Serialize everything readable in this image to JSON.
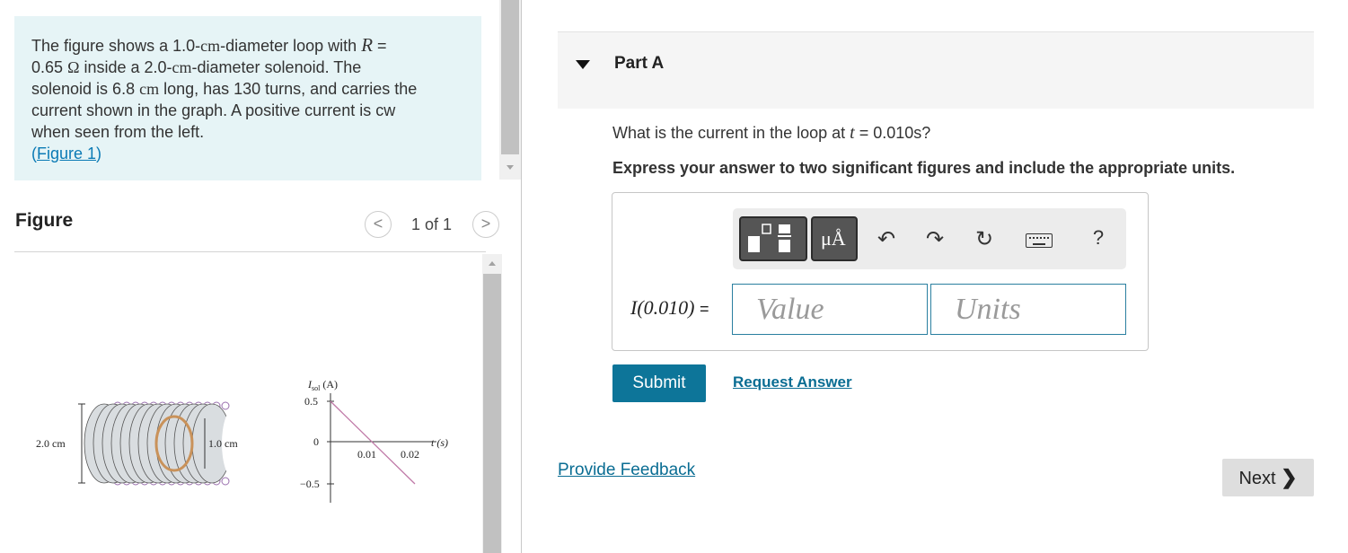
{
  "problem": {
    "text_1": "The figure shows a 1.0-",
    "unit_cm": "cm",
    "text_2": "-diameter loop with ",
    "R_symbol": "R",
    "text_3": " =",
    "resistance": "0.65",
    "ohm": "Ω",
    "text_4": " inside a 2.0-",
    "text_5": "-diameter solenoid. The",
    "text_6": "solenoid is 6.8 ",
    "text_7": " long, has 130 turns, and carries the",
    "text_8": "current shown in the graph. A positive current is cw",
    "text_9": "when seen from the left.",
    "figure_link": "Figure 1"
  },
  "figure_panel": {
    "title": "Figure",
    "pager": "1 of 1",
    "prev": "<",
    "next": ">",
    "diagram": {
      "label_solenoid": "2.0 cm",
      "label_loop": "1.0 cm"
    },
    "graph": {
      "ylabel_I": "I",
      "ylabel_sub": "sol",
      "ylabel_unit": "(A)",
      "xlabel": "t (s)",
      "y_ticks": [
        "0.5",
        "0",
        "−0.5"
      ],
      "x_ticks": [
        "0.01",
        "0.02"
      ],
      "points": [
        [
          0,
          0.5
        ],
        [
          0.02,
          -0.5
        ]
      ]
    }
  },
  "part": {
    "label": "Part A"
  },
  "question": {
    "text_before": "What is the current in the loop at ",
    "var": "t",
    "text_after": " = 0.010s?",
    "instruction": "Express your answer to two significant figures and include the appropriate units."
  },
  "toolbar": {
    "units_label": "μÅ",
    "help": "?"
  },
  "answer": {
    "label": "I(0.010)",
    "equals": "=",
    "value_placeholder": "Value",
    "units_placeholder": "Units"
  },
  "actions": {
    "submit": "Submit",
    "request_answer": "Request Answer",
    "feedback": "Provide Feedback",
    "next": "Next"
  },
  "colors": {
    "problem_bg": "#e6f4f6",
    "link": "#0a7ab5",
    "submit_bg": "#0d7599",
    "input_border": "#2a7fa0"
  }
}
